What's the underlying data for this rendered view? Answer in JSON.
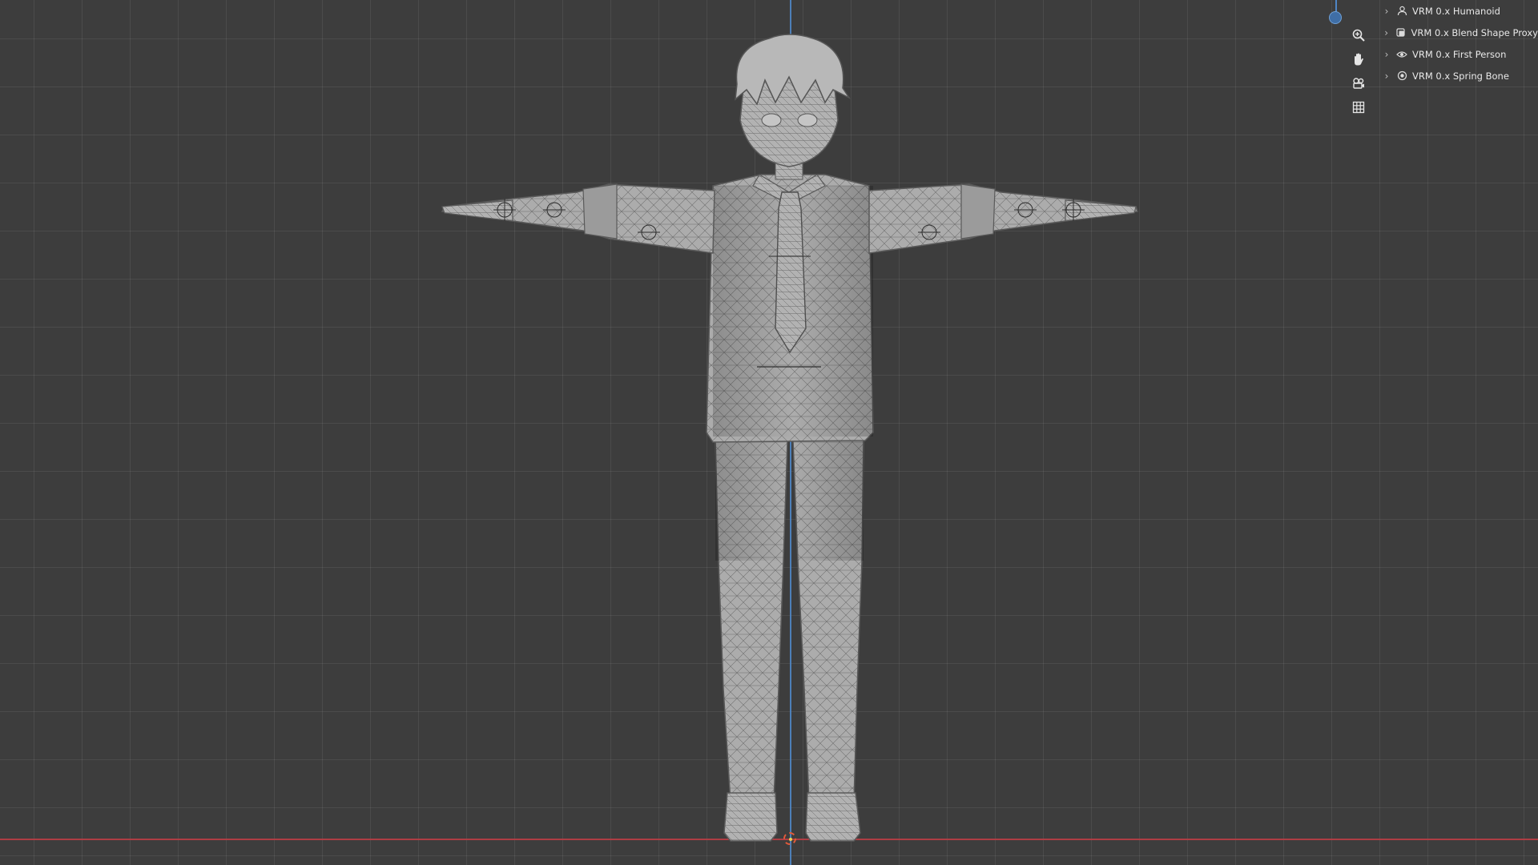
{
  "panel": {
    "items": [
      {
        "label": "VRM 0.x Humanoid",
        "icon": "person-icon"
      },
      {
        "label": "VRM 0.x Blend Shape Proxy",
        "icon": "shape-icon"
      },
      {
        "label": "VRM 0.x First Person",
        "icon": "eye-icon"
      },
      {
        "label": "VRM 0.x Spring Bone",
        "icon": "spring-bone-icon"
      }
    ]
  },
  "navigation": {
    "tools": [
      "zoom-icon",
      "hand-pan-icon",
      "camera-icon",
      "grid-icon"
    ]
  },
  "colors": {
    "background": "#3d3d3d",
    "z_axis": "#4f86c5",
    "x_axis": "#b43d43",
    "mesh": "#a9a9a9"
  }
}
